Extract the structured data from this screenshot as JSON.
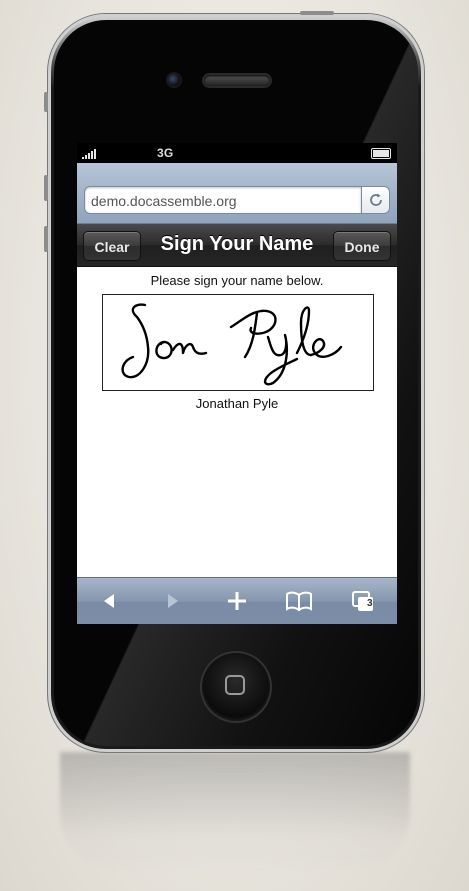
{
  "status_bar": {
    "network": "3G",
    "battery_level": 1.0
  },
  "browser": {
    "url": "demo.docassemble.org",
    "reload_icon": "reload-icon",
    "tab_count": "3"
  },
  "nav": {
    "clear_label": "Clear",
    "title": "Sign Your Name",
    "done_label": "Done"
  },
  "content": {
    "instructions": "Please sign your name below.",
    "signature": "Jon Pyle",
    "signer_name": "Jonathan Pyle"
  },
  "toolbar": {
    "back_icon": "back-arrow-icon",
    "forward_icon": "forward-arrow-icon",
    "add_icon": "plus-icon",
    "bookmarks_icon": "book-icon",
    "pages_icon": "pages-icon"
  },
  "colors": {
    "toolbar_blue": "#8496ae",
    "nav_dark": "#2b2b2b",
    "url_bar_blue": "#9fb1c6"
  }
}
